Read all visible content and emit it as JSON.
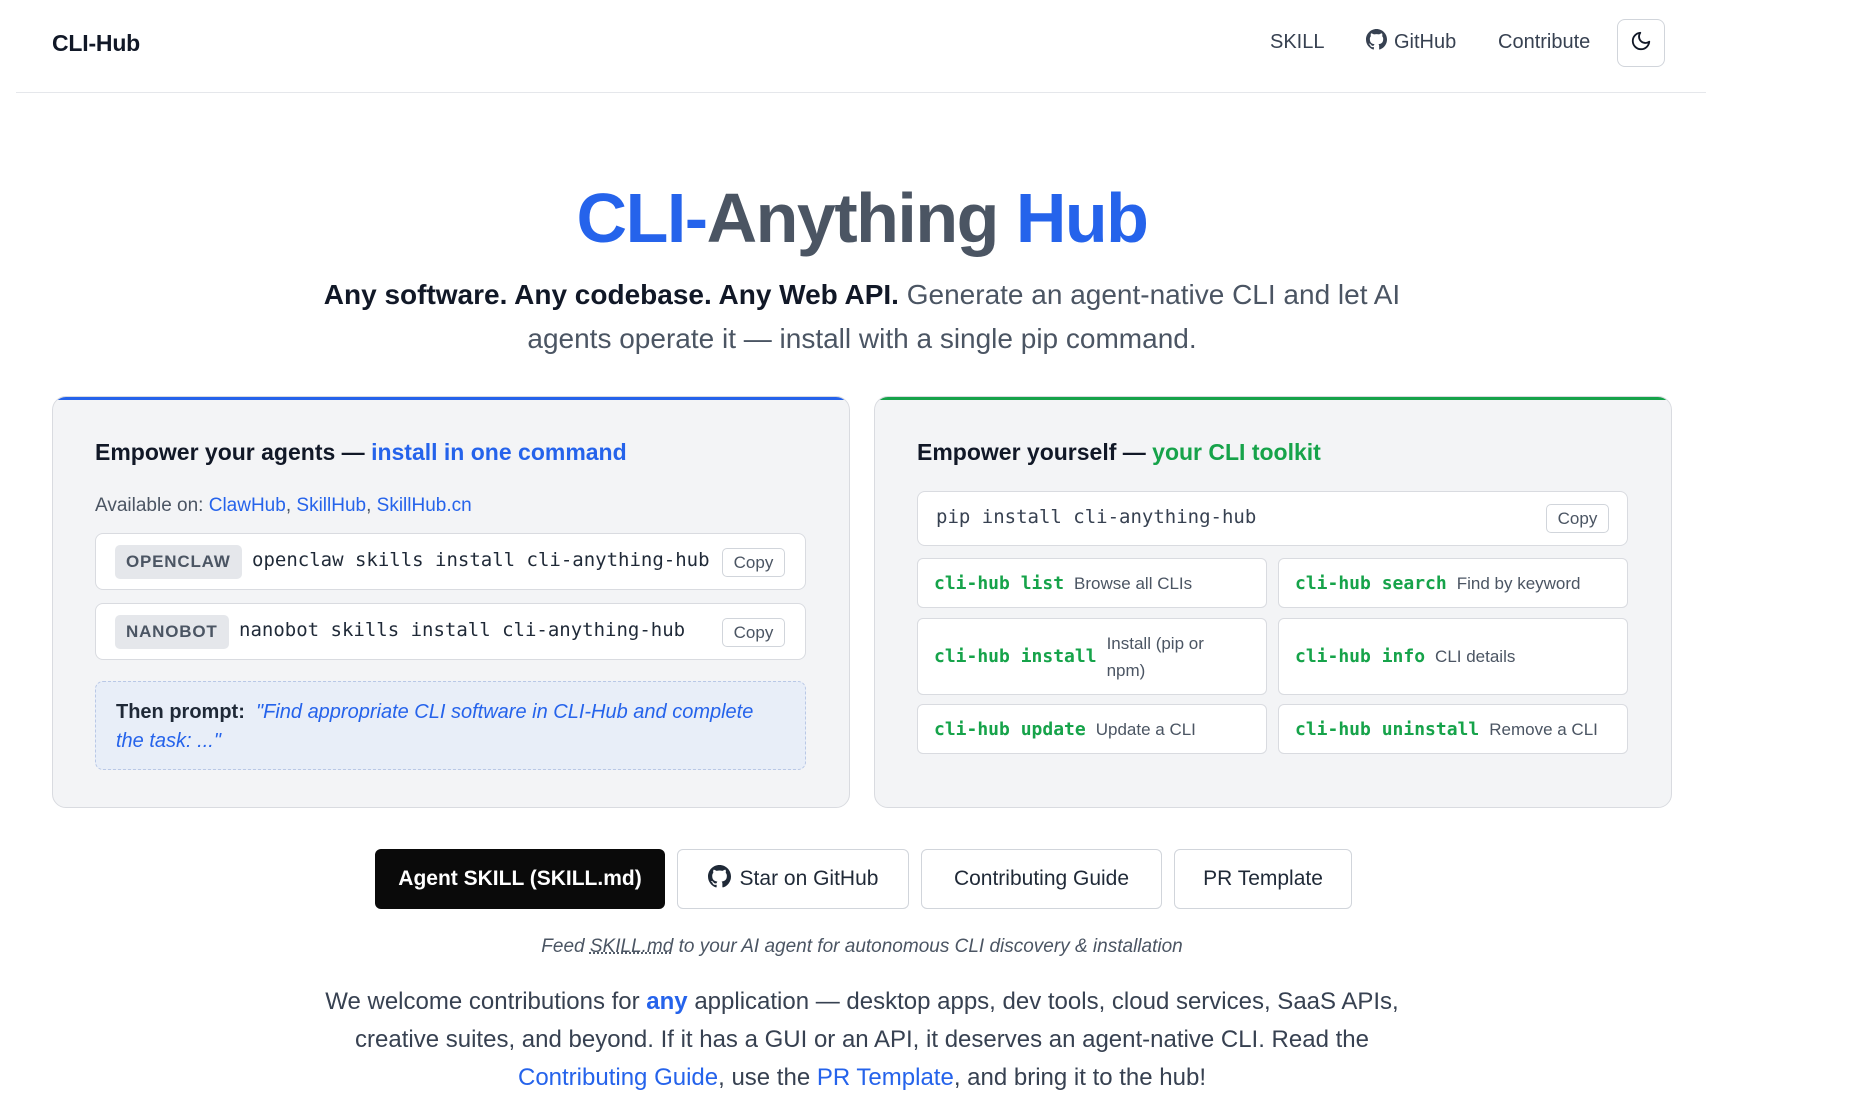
{
  "header": {
    "brand": "CLI-Hub",
    "nav": {
      "skill": "SKILL",
      "github": "GitHub",
      "contribute": "Contribute"
    },
    "theme_toggle_icon": "moon-icon"
  },
  "hero": {
    "title_part1": "CLI-",
    "title_part2": "Anything",
    "title_part3": "Hub",
    "subtitle_bold": "Any software. Any codebase. Any Web API.",
    "subtitle_rest": " Generate an agent-native CLI and let AI agents operate it — install with a single pip command."
  },
  "agents_card": {
    "title_prefix": "Empower your agents — ",
    "title_accent": "install in one command",
    "available_label": "Available on: ",
    "platforms": [
      "ClawHub",
      "SkillHub",
      "SkillHub.cn"
    ],
    "commands": [
      {
        "badge": "OPENCLAW",
        "command": "openclaw skills install cli-anything-hub",
        "copy": "Copy"
      },
      {
        "badge": "NANOBOT",
        "command": "nanobot skills install cli-anything-hub",
        "copy": "Copy"
      }
    ],
    "prompt_label": "Then prompt:",
    "prompt_text": "\"Find appropriate CLI software in CLI-Hub and complete the task: ...\""
  },
  "toolkit_card": {
    "title_prefix": "Empower yourself — ",
    "title_accent": "your CLI toolkit",
    "pip_command": "pip install cli-anything-hub",
    "copy": "Copy",
    "commands": [
      {
        "cmd": "cli-hub list",
        "desc": "Browse all CLIs"
      },
      {
        "cmd": "cli-hub search",
        "desc": "Find by keyword"
      },
      {
        "cmd": "cli-hub install",
        "desc": "Install (pip or npm)"
      },
      {
        "cmd": "cli-hub info",
        "desc": "CLI details"
      },
      {
        "cmd": "cli-hub update",
        "desc": "Update a CLI"
      },
      {
        "cmd": "cli-hub uninstall",
        "desc": "Remove a CLI"
      }
    ]
  },
  "actions": {
    "agent_skill": "Agent SKILL (SKILL.md)",
    "star_github": "Star on GitHub",
    "contributing_guide": "Contributing Guide",
    "pr_template": "PR Template"
  },
  "feed_note": {
    "before": "Feed ",
    "abbr": "SKILL.md",
    "after": " to your AI agent for autonomous CLI discovery & installation"
  },
  "welcome": {
    "part1": "We welcome contributions for ",
    "any": "any",
    "part2": " application — desktop apps, dev tools, cloud services, SaaS APIs, creative suites, and beyond. If it has a GUI or an API, it deserves an agent-native CLI. Read the ",
    "link1": "Contributing Guide",
    "part3": ", use the ",
    "link2": "PR Template",
    "part4": ", and bring it to the hub!"
  },
  "colors": {
    "accent_blue": "#2563eb",
    "accent_green": "#16a34a",
    "primary_button": "#0a0a0a"
  }
}
